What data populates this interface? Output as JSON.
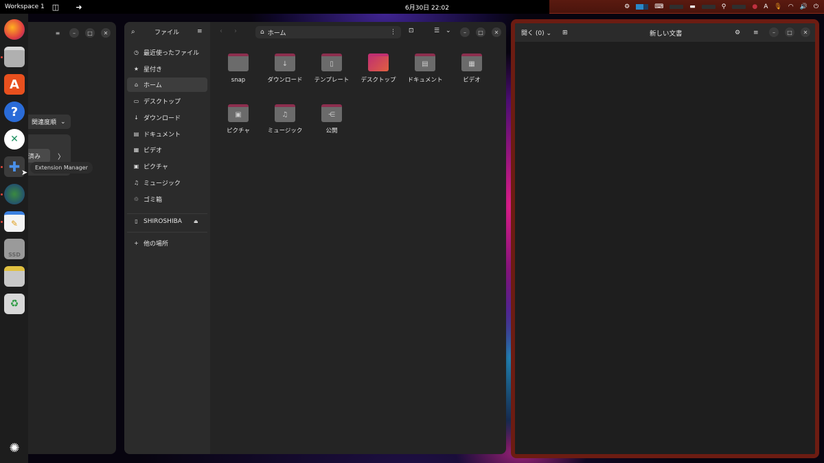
{
  "topbar": {
    "workspace": "Workspace 1",
    "clock": "6月30日  22:02",
    "tray_lang": "A"
  },
  "dock": {
    "items": [
      "firefox-icon",
      "files-icon",
      "app-center-icon",
      "help-icon",
      "remote-desktop-icon",
      "extension-manager-icon",
      "globe-icon",
      "text-editor-icon",
      "ssd-drive-icon",
      "sd-card-icon",
      "trash-icon"
    ],
    "ssd_label": "SSD"
  },
  "left_window": {
    "sort_label": "関連度順",
    "done_label": "済み",
    "tooltip": "Extension Manager"
  },
  "files": {
    "title": "ファイル",
    "path": "ホーム",
    "sidebar": [
      {
        "label": "最近使ったファイル",
        "icon": "◷"
      },
      {
        "label": "星付き",
        "icon": "★"
      },
      {
        "label": "ホーム",
        "icon": "⌂"
      },
      {
        "label": "デスクトップ",
        "icon": "▭"
      },
      {
        "label": "ダウンロード",
        "icon": "↓"
      },
      {
        "label": "ドキュメント",
        "icon": "▤"
      },
      {
        "label": "ビデオ",
        "icon": "▦"
      },
      {
        "label": "ピクチャ",
        "icon": "▣"
      },
      {
        "label": "ミュージック",
        "icon": "♫"
      },
      {
        "label": "ゴミ箱",
        "icon": "♲"
      }
    ],
    "drive": "SHIROSHIBA",
    "other_places": "他の場所",
    "folders": [
      {
        "name": "snap",
        "icon": ""
      },
      {
        "name": "ダウンロード",
        "icon": "↓"
      },
      {
        "name": "テンプレート",
        "icon": "▯"
      },
      {
        "name": "デスクトップ",
        "icon": ""
      },
      {
        "name": "ドキュメント",
        "icon": "▤"
      },
      {
        "name": "ビデオ",
        "icon": "▦"
      },
      {
        "name": "ピクチャ",
        "icon": "▣"
      },
      {
        "name": "ミュージック",
        "icon": "♫"
      },
      {
        "name": "公開",
        "icon": "⋲"
      }
    ]
  },
  "editor": {
    "open_label": "開く (0)",
    "title": "新しい文書"
  }
}
